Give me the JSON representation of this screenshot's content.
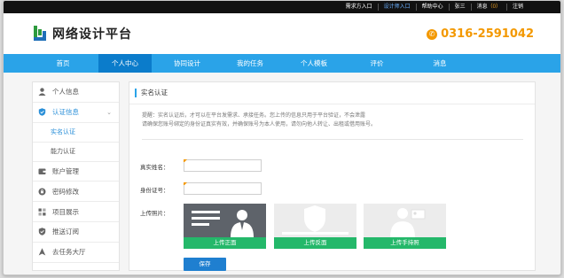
{
  "topbar": {
    "links": [
      {
        "label": "需求方入口",
        "active": false
      },
      {
        "label": "设计师入口",
        "active": true
      },
      {
        "label": "帮助中心",
        "active": false
      },
      {
        "label": "张三",
        "active": false
      }
    ],
    "messages_label": "消息",
    "messages_count": "（0）",
    "logout_label": "注销"
  },
  "header": {
    "brand": "网络设计平台",
    "phone": "0316-2591042",
    "phone_icon": "phone-icon"
  },
  "nav": {
    "items": [
      "首页",
      "个人中心",
      "协同设计",
      "我的任务",
      "个人模板",
      "评价",
      "消息"
    ],
    "active_index": 1
  },
  "sidebar": {
    "items": [
      {
        "label": "个人信息",
        "icon": "person-icon"
      },
      {
        "label": "认证信息",
        "icon": "shield-check-icon"
      },
      {
        "label": "账户管理",
        "icon": "wallet-icon"
      },
      {
        "label": "密码修改",
        "icon": "lock-icon"
      },
      {
        "label": "项目展示",
        "icon": "grid-icon"
      },
      {
        "label": "推送订阅",
        "icon": "badge-icon"
      },
      {
        "label": "去任务大厅",
        "icon": "navigate-icon"
      }
    ],
    "sub_items": [
      "实名认证",
      "能力认证"
    ]
  },
  "main": {
    "title": "实名认证",
    "notice_line1": "提醒：实名认证后，才可以在平台发需求、承接任务。您上传的信息只用于平台验证，不会泄露",
    "notice_line2": "请确保您账号绑定的身份证真实有效，并确保账号为本人使用，请勿向他人转让、出租或借用账号。",
    "form": {
      "name_label": "真实姓名：",
      "name_value": "",
      "id_label": "身份证号：",
      "id_value": "",
      "photo_label": "上传照片："
    },
    "uploads": [
      {
        "label": "上传正面"
      },
      {
        "label": "上传反面"
      },
      {
        "label": "上传手持照"
      }
    ],
    "save_label": "保存"
  },
  "colors": {
    "nav_blue": "#2aa3e8",
    "nav_active": "#0b7ccb",
    "accent_orange": "#f39800",
    "upload_green": "#24b86a",
    "save_blue": "#1f7fd0",
    "link_blue": "#2a8fd8"
  }
}
